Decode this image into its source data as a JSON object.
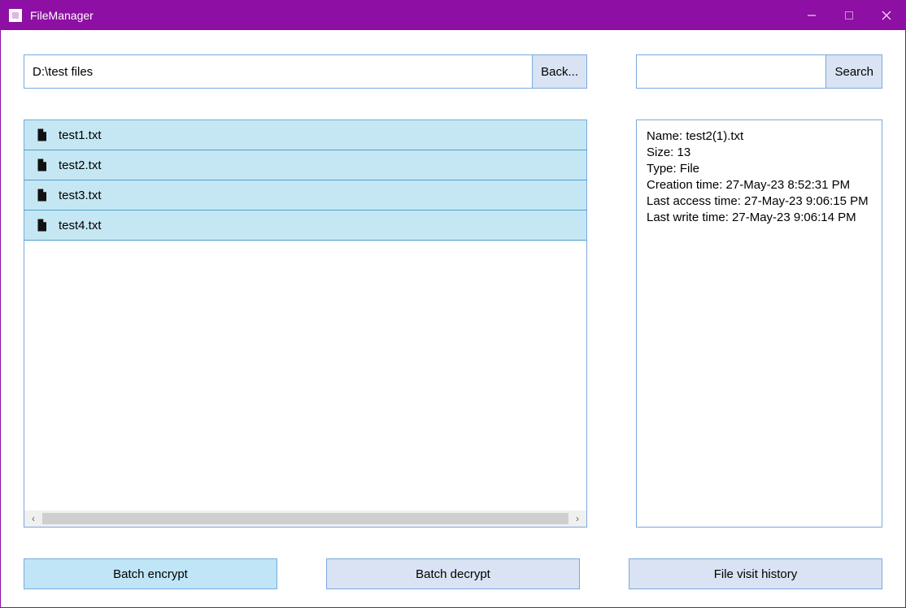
{
  "window": {
    "title": "FileManager"
  },
  "path": {
    "value": "D:\\test files",
    "back_label": "Back..."
  },
  "search": {
    "value": "",
    "button_label": "Search"
  },
  "files": [
    {
      "name": "test1.txt"
    },
    {
      "name": "test2.txt"
    },
    {
      "name": "test3.txt"
    },
    {
      "name": "test4.txt"
    }
  ],
  "details": {
    "name_label": "Name: ",
    "name": "test2(1).txt",
    "size_label": "Size: ",
    "size": "13",
    "type_label": "Type: ",
    "type": "File",
    "creation_label": "Creation time: ",
    "creation": "27-May-23 8:52:31 PM",
    "access_label": "Last access time: ",
    "access": "27-May-23 9:06:15 PM",
    "write_label": "Last write time: ",
    "write": "27-May-23 9:06:14 PM"
  },
  "buttons": {
    "encrypt": "Batch encrypt",
    "decrypt": "Batch decrypt",
    "history": "File visit history"
  }
}
